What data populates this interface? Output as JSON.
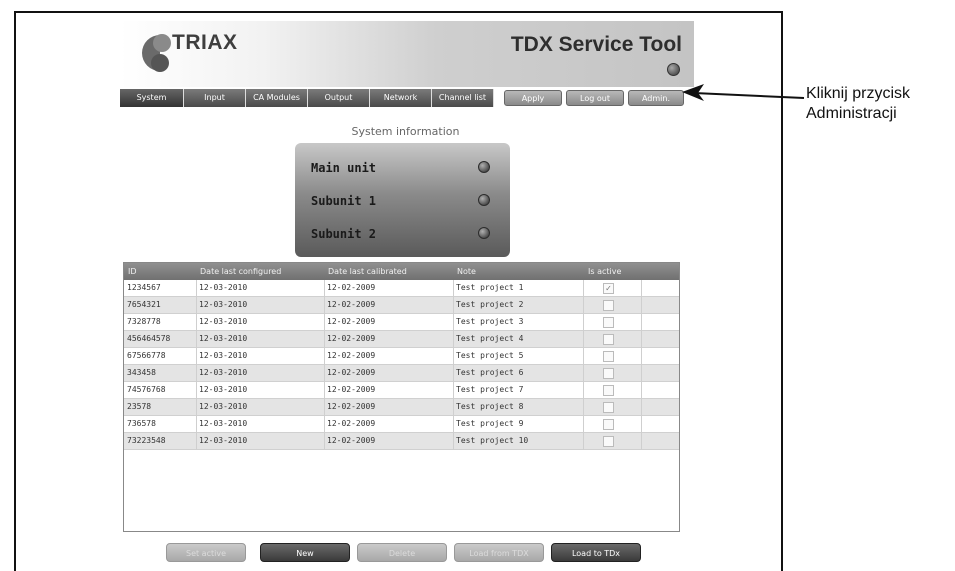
{
  "header": {
    "logo_text": "TRIAX",
    "title": "TDX Service Tool"
  },
  "nav": {
    "tabs": [
      {
        "label": "System",
        "active": true
      },
      {
        "label": "Input",
        "active": false
      },
      {
        "label": "CA Modules",
        "active": false
      },
      {
        "label": "Output",
        "active": false
      },
      {
        "label": "Network",
        "active": false
      },
      {
        "label": "Channel list",
        "active": false
      }
    ],
    "buttons": [
      "Apply",
      "Log out",
      "Admin."
    ]
  },
  "system": {
    "title": "System information",
    "units": [
      "Main unit",
      "Subunit 1",
      "Subunit 2"
    ]
  },
  "table": {
    "columns": [
      "ID",
      "Date last configured",
      "Date last calibrated",
      "Note",
      "Is active"
    ],
    "rows": [
      {
        "id": "1234567",
        "configured": "12-03-2010",
        "calibrated": "12-02-2009",
        "note": "Test project 1",
        "active": true
      },
      {
        "id": "7654321",
        "configured": "12-03-2010",
        "calibrated": "12-02-2009",
        "note": "Test project 2",
        "active": false
      },
      {
        "id": "7328778",
        "configured": "12-03-2010",
        "calibrated": "12-02-2009",
        "note": "Test project 3",
        "active": false
      },
      {
        "id": "456464578",
        "configured": "12-03-2010",
        "calibrated": "12-02-2009",
        "note": "Test project 4",
        "active": false
      },
      {
        "id": "67566778",
        "configured": "12-03-2010",
        "calibrated": "12-02-2009",
        "note": "Test project 5",
        "active": false
      },
      {
        "id": "343458",
        "configured": "12-03-2010",
        "calibrated": "12-02-2009",
        "note": "Test project 6",
        "active": false
      },
      {
        "id": "74576768",
        "configured": "12-03-2010",
        "calibrated": "12-02-2009",
        "note": "Test project 7",
        "active": false
      },
      {
        "id": "23578",
        "configured": "12-03-2010",
        "calibrated": "12-02-2009",
        "note": "Test project 8",
        "active": false
      },
      {
        "id": "736578",
        "configured": "12-03-2010",
        "calibrated": "12-02-2009",
        "note": "Test project 9",
        "active": false
      },
      {
        "id": "73223548",
        "configured": "12-03-2010",
        "calibrated": "12-02-2009",
        "note": "Test project 10",
        "active": false
      }
    ]
  },
  "actions": [
    {
      "label": "Set active",
      "enabled": false
    },
    {
      "label": "New",
      "enabled": true
    },
    {
      "label": "Delete",
      "enabled": false
    },
    {
      "label": "Load from TDX",
      "enabled": false
    },
    {
      "label": "Load to TDx",
      "enabled": true
    }
  ],
  "annotation": {
    "line1": "Kliknij przycisk",
    "line2": "Administracji"
  },
  "icons": {
    "logo": "triax-logo-icon",
    "status": "status-led-icon",
    "check": "checkmark-icon",
    "arrow": "arrow-left-icon"
  }
}
